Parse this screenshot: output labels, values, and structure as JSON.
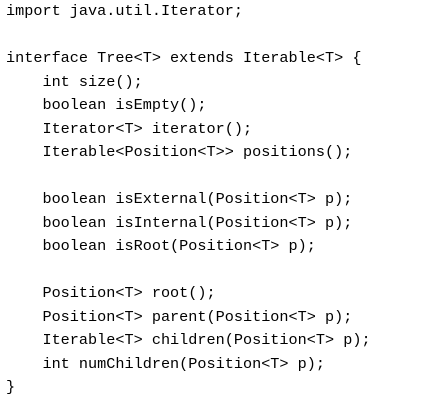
{
  "code": {
    "lines": [
      "import java.util.Iterator;",
      "",
      "interface Tree<T> extends Iterable<T> {",
      "    int size();",
      "    boolean isEmpty();",
      "    Iterator<T> iterator();",
      "    Iterable<Position<T>> positions();",
      "",
      "    boolean isExternal(Position<T> p);",
      "    boolean isInternal(Position<T> p);",
      "    boolean isRoot(Position<T> p);",
      "",
      "    Position<T> root();",
      "    Position<T> parent(Position<T> p);",
      "    Iterable<T> children(Position<T> p);",
      "    int numChildren(Position<T> p);",
      "}"
    ]
  }
}
